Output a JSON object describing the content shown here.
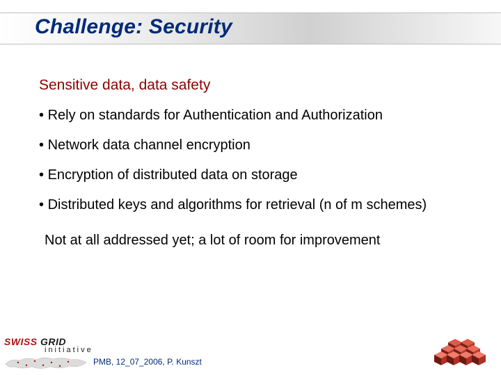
{
  "title": "Challenge: Security",
  "subtitle": "Sensitive data, data safety",
  "bullets": [
    "Rely on standards for Authentication and Authorization",
    "Network data channel encryption",
    "Encryption of distributed data on storage",
    "Distributed keys and algorithms for retrieval (n of m schemes)"
  ],
  "closing": "Not at all addressed yet; a lot of room for improvement",
  "footer": "PMB,  12_07_2006,  P. Kunszt",
  "logo_left": {
    "line1a": "SWISS",
    "line1b": " GRID",
    "line2": "initiative"
  }
}
